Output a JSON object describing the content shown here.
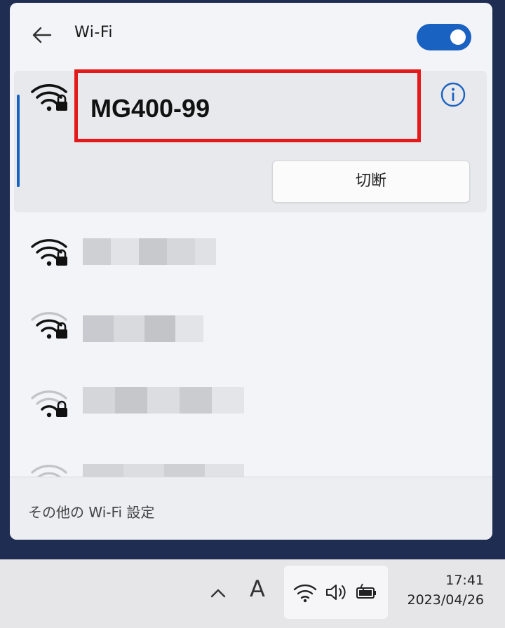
{
  "header": {
    "title": "Wi-Fi",
    "back_icon": "back-arrow-icon",
    "wifi_toggle": "on"
  },
  "connected_network": {
    "name": "MG400-99",
    "icon": "wifi-secured-icon",
    "info_icon": "info-icon",
    "disconnect_label": "切断"
  },
  "other_networks": [
    {
      "name": "",
      "obscured": true
    },
    {
      "name": "",
      "obscured": true
    },
    {
      "name": "",
      "obscured": true
    },
    {
      "name": "",
      "obscured": true
    }
  ],
  "footer": {
    "more_settings_label": "その他の Wi-Fi 設定"
  },
  "taskbar": {
    "chevron_icon": "chevron-up-icon",
    "ime_label": "A",
    "tray_icons": [
      "wifi-icon",
      "speaker-icon",
      "battery-icon"
    ],
    "time": "17:41",
    "date": "2023/04/26"
  },
  "colors": {
    "accent": "#1a62c2",
    "highlight_box": "#e41a1a",
    "desktop_background": "#1f2d52"
  }
}
